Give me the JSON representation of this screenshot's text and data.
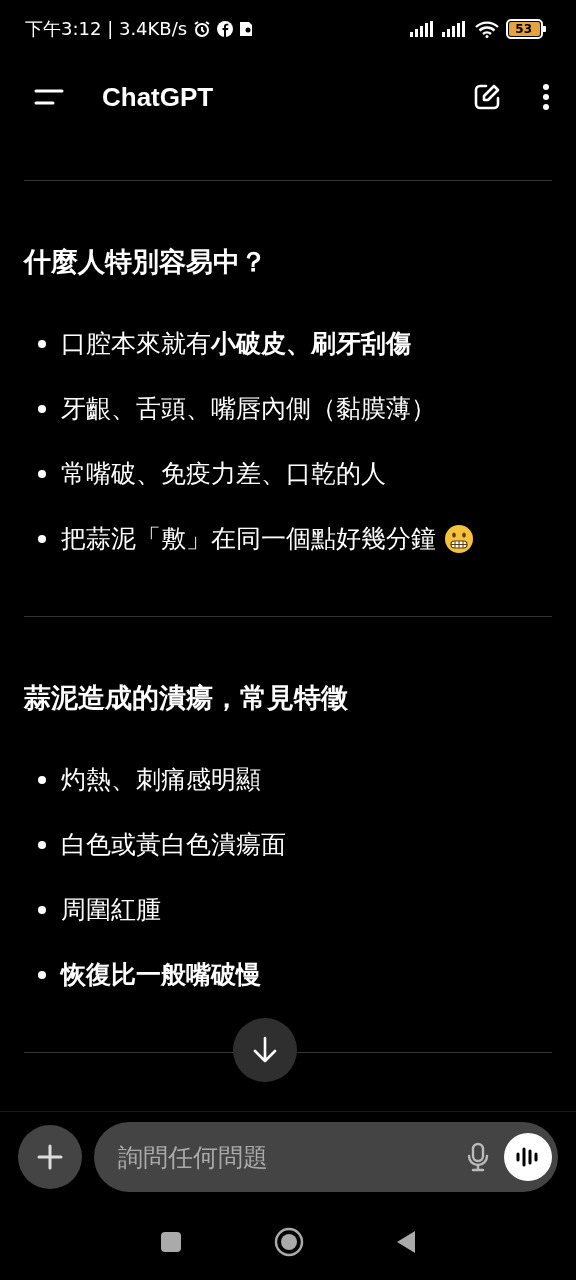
{
  "status_bar": {
    "time": "下午3:12 | 3.4KB/s",
    "battery": "53"
  },
  "header": {
    "title": "ChatGPT"
  },
  "sections": [
    {
      "heading": "什麼人特別容易中？",
      "items": [
        {
          "text": "口腔本來就有**小破皮、刷牙刮傷**",
          "bold": false,
          "has_emoji": false
        },
        {
          "text": "牙齦、舌頭、嘴唇內側（黏膜薄）",
          "bold": false,
          "has_emoji": false
        },
        {
          "text": "常嘴破、免疫力差、口乾的人",
          "bold": false,
          "has_emoji": false
        },
        {
          "text": "把蒜泥「敷」在同一個點好幾分鐘",
          "bold": false,
          "has_emoji": true
        }
      ]
    },
    {
      "heading": "蒜泥造成的潰瘍，常見特徵",
      "items": [
        {
          "text": "灼熱、刺痛感明顯",
          "bold": false,
          "has_emoji": false
        },
        {
          "text": "白色或黃白色潰瘍面",
          "bold": false,
          "has_emoji": false
        },
        {
          "text": "周圍紅腫",
          "bold": false,
          "has_emoji": false
        },
        {
          "text": "恢復比一般嘴破慢",
          "bold": true,
          "has_emoji": false
        }
      ]
    }
  ],
  "composer": {
    "placeholder": "詢問任何問題"
  }
}
